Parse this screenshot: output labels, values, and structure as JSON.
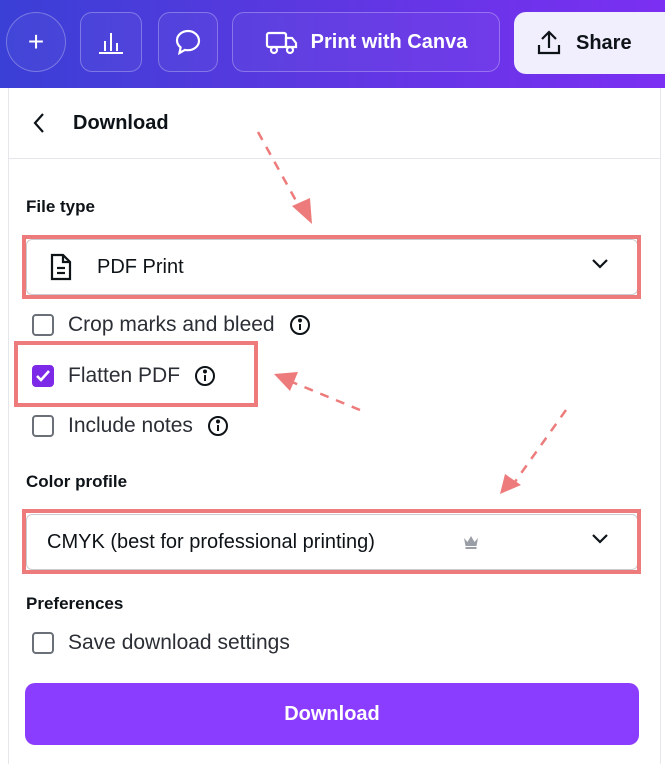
{
  "toolbar": {
    "plus_icon": "plus-icon",
    "chart_icon": "bar-chart-icon",
    "comment_icon": "comment-icon",
    "print_label": "Print with Canva",
    "print_icon": "truck-icon",
    "share_label": "Share",
    "share_icon": "upload-icon"
  },
  "panel": {
    "back_icon": "chevron-left-icon",
    "title": "Download",
    "file_type": {
      "label": "File type",
      "selected": "PDF Print",
      "icon": "document-icon"
    },
    "options": [
      {
        "label": "Crop marks and bleed",
        "checked": false,
        "info": true
      },
      {
        "label": "Flatten PDF",
        "checked": true,
        "info": true
      },
      {
        "label": "Include notes",
        "checked": false,
        "info": true
      }
    ],
    "color_profile": {
      "label": "Color profile",
      "selected": "CMYK (best for professional printing)",
      "badge_icon": "crown-icon"
    },
    "preferences": {
      "label": "Preferences",
      "save_settings": "Save download settings",
      "checked": false
    },
    "download_button": "Download"
  },
  "colors": {
    "toolbar_start": "#3a3fd6",
    "toolbar_end": "#7b2ff2",
    "accent": "#8b3dff",
    "checkbox_on": "#7d2ae8",
    "highlight": "#ee7b7b"
  }
}
